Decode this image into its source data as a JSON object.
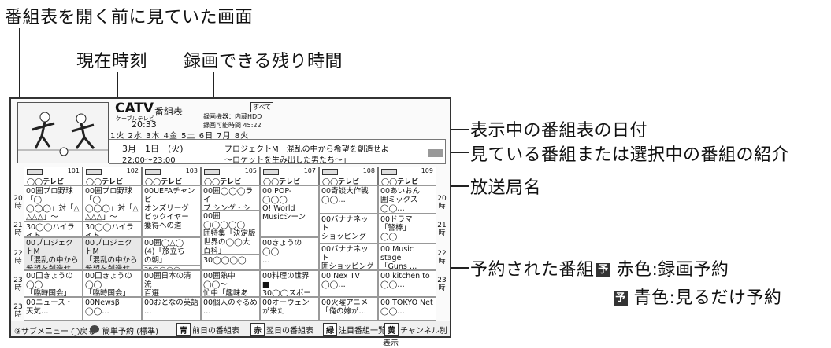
{
  "callouts": {
    "before_screen": "番組表を開く前に見ていた画面",
    "current_time": "現在時刻",
    "rec_remaining": "録画できる残り時間",
    "date_shown": "表示中の番組表の日付",
    "program_intro": "見ている番組または選択中の番組の紹介",
    "station_name": "放送局名",
    "reserved": "予約された番組",
    "red_label": "赤色:録画予約",
    "blue_label": "青色:見るだけ予約",
    "yoyaku_glyph": "予"
  },
  "screen": {
    "catv": "CATV",
    "title": "番組表",
    "sub": "ケーブルテレビ",
    "time": "20:33",
    "rec_device": "録画機器：内蔵HDD",
    "rec_time": "録画可能時間 45:22",
    "all_tab": "すべて",
    "dates": "1火 2水 3木 4金 5土 6日 7月 8火",
    "date_line": "3月　1日　(火)",
    "time_line": "22:00〜23:00",
    "info1": "プロジェクトM「混乱の中から希望を創造せよ",
    "info2": "〜ロケットを生み出した男たち〜」"
  },
  "channels": [
    {
      "num": "101",
      "name": "◯◯テレビ"
    },
    {
      "num": "102",
      "name": "◯◯テレビ"
    },
    {
      "num": "103",
      "name": "◯◯テレビ"
    },
    {
      "num": "105",
      "name": "◯◯テレビ"
    },
    {
      "num": "107",
      "name": "◯◯テレビ"
    },
    {
      "num": "108",
      "name": "◯◯テレビ"
    },
    {
      "num": "109",
      "name": "◯◯テレビ"
    }
  ],
  "hours": [
    "20\n時",
    "21\n時",
    "22\n時",
    "23\n時",
    "23\n時"
  ],
  "cells": {
    "c0a": "00囲プロ野球「◯\n◯◯◯」対「△\n△△△」〜\n◯◯…",
    "c0b": "30◯◯ハイライト",
    "c0c": "00プロジェクトM\n「混乱の中から\n希望を創造せ",
    "c0d": "00囗きょうの◯◯\n「臨時国会」",
    "c0e": "00ニュース・\n天気…",
    "c1a": "00囲プロ野球「◯\n◯◯◯」対「△\n△△△」〜\n◯◯…",
    "c1b": "30◯◯ハイライト",
    "c1c": "00プロジェクトM\n「混乱の中から\n希望を創造せ",
    "c1d": "00囗きょうの◯◯\n「臨時国会」",
    "c1e": "00Newsβ\n◯◯…",
    "c2a": "00UEFAチャンピ\nオンズリーグ\nピックイヤー\n獲得への道",
    "c2b": "00囲◯△◯\n(4)「旅立ち\nの朝」",
    "c2c": "30◯◯◯◯",
    "c2d": "00囲日本の清流\n百選",
    "c2e": "00おとなの英語\n…",
    "c3a": "00囲◯◯◯ライ\nブ シング・シ",
    "c3b": "00囲◯◯◯◯◯\n囲特集「決定版\n世界の◯◯大\n百科」",
    "c3c": "30◯◯◯◯",
    "c3d": "00囲熱中◯◯〜\n忙中「趣味あ\nり「盆栽」",
    "c3e": "00個人のぐるめ\n…",
    "c4a": "00 POP-◯◯◯\nO! World\nMusicシーン",
    "c4b": "00きょうの◯◯\n…",
    "c4c": "00料理の世界\n■\n30◯◯スポー\nニュース",
    "c4d": "00オーウェン\nが来た",
    "c5a": "00奇談大作戦\n◯◯…",
    "c5b": "00バナナネット\nショッピング",
    "c5c": "00バナナネット\n囲ショッピング",
    "c5d": "00 Nex TV\n◯◯…",
    "c5e": "00火曜アニメ\n「俺の嫁が…",
    "c6a": "00あいおん\n囲ミックス\n◯◯…",
    "c6b": "00ドラマ\n「警棒」\n◯◯",
    "c6c": "00 Music stage\n「Guns …",
    "c6d": "00 kitchen to\n◯◯…",
    "c6e": "00 TOKYO Net\n◯◯…"
  },
  "bottom": {
    "menu": "⑨サブメニュー ◯戻る",
    "quick": "簡単予約 (標準)",
    "blue_key": "青",
    "prev": "前日の番組表",
    "red_key": "赤",
    "next": "翌日の番組表",
    "green_key": "緑",
    "featured": "注目番組一覧",
    "yellow_key": "黄",
    "channel": "チャンネル別表示"
  }
}
